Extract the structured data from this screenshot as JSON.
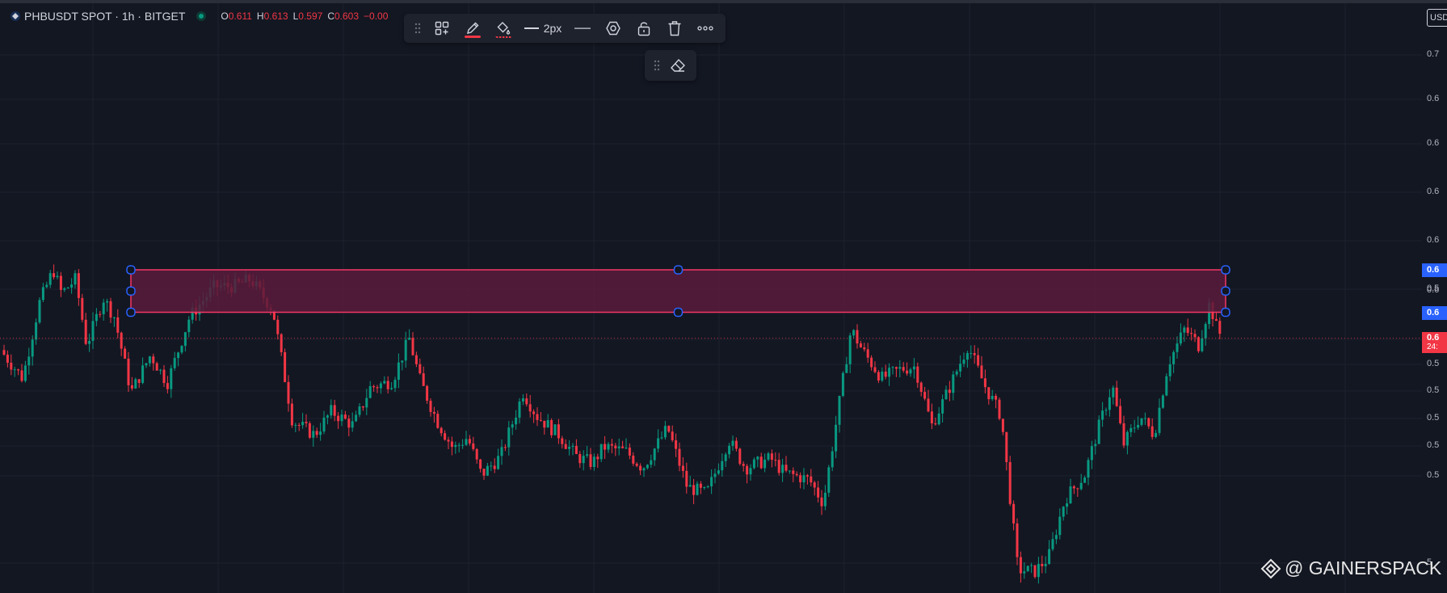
{
  "legend": {
    "symbol": "PHBUSDT SPOT · 1h · BITGET",
    "o_label": "O",
    "o_value": "0.611",
    "h_label": "H",
    "h_value": "0.613",
    "l_label": "L",
    "l_value": "0.597",
    "c_label": "C",
    "c_value": "0.603",
    "change": "−0.00"
  },
  "toolbar": {
    "grip_icon": "drag-handle-icon",
    "templates_icon": "templates-icon",
    "pencil_icon": "pencil-icon",
    "fill_icon": "fill-bucket-icon",
    "line_width_label": "2px",
    "line_style_icon": "line-style-icon",
    "settings_icon": "hexagon-settings-icon",
    "lock_icon": "unlock-icon",
    "delete_icon": "trash-icon",
    "more_icon": "more-icon",
    "eraser_icon": "eraser-icon"
  },
  "axis": {
    "currency_button": "USD",
    "ticks": [
      "0.7",
      "0.6",
      "0.6",
      "0.6",
      "0.6",
      "0.5",
      "0.5",
      "0.5",
      "0.5",
      "0.5",
      "0.5",
      "0.5",
      "5"
    ],
    "tag_top": "0.6",
    "tag_mid": "0.6",
    "tag_bottom": "0.6",
    "tag_current": "0.6",
    "tag_countdown": "24:"
  },
  "colors": {
    "background": "#131722",
    "up": "#089981",
    "down": "#f23645",
    "rect_fill": "#5b1b3b",
    "rect_border": "#f23665",
    "handle": "#2962ff"
  },
  "watermark": "@ GAINERSPACK",
  "chart_data": {
    "type": "candlestick",
    "symbol": "PHBUSDT",
    "interval": "1h",
    "exchange": "BITGET",
    "last_ohlc": {
      "open": 0.611,
      "high": 0.613,
      "low": 0.597,
      "close": 0.603
    },
    "trend": [
      [
        0,
        0.598
      ],
      [
        0.04,
        0.586
      ],
      [
        0.07,
        0.618
      ],
      [
        0.095,
        0.632
      ],
      [
        0.11,
        0.622
      ],
      [
        0.135,
        0.628
      ],
      [
        0.155,
        0.6
      ],
      [
        0.185,
        0.62
      ],
      [
        0.205,
        0.612
      ],
      [
        0.235,
        0.58
      ],
      [
        0.27,
        0.596
      ],
      [
        0.3,
        0.584
      ],
      [
        0.34,
        0.612
      ],
      [
        0.385,
        0.625
      ],
      [
        0.42,
        0.625
      ],
      [
        0.45,
        0.628
      ],
      [
        0.49,
        0.615
      ],
      [
        0.525,
        0.568
      ],
      [
        0.565,
        0.562
      ],
      [
        0.595,
        0.572
      ],
      [
        0.635,
        0.566
      ],
      [
        0.665,
        0.582
      ],
      [
        0.705,
        0.585
      ],
      [
        0.735,
        0.603
      ],
      [
        0.755,
        0.585
      ],
      [
        0.785,
        0.568
      ],
      [
        0.815,
        0.556
      ],
      [
        0.84,
        0.561
      ],
      [
        0.865,
        0.545
      ],
      [
        0.9,
        0.553
      ],
      [
        0.94,
        0.58
      ],
      [
        0.965,
        0.57
      ],
      [
        1.005,
        0.562
      ],
      [
        1.035,
        0.553
      ],
      [
        1.065,
        0.55
      ],
      [
        1.085,
        0.557
      ],
      [
        1.125,
        0.555
      ],
      [
        1.155,
        0.548
      ],
      [
        1.2,
        0.565
      ],
      [
        1.235,
        0.54
      ],
      [
        1.27,
        0.537
      ],
      [
        1.31,
        0.56
      ],
      [
        1.34,
        0.548
      ],
      [
        1.385,
        0.552
      ],
      [
        1.41,
        0.546
      ],
      [
        1.455,
        0.543
      ],
      [
        1.48,
        0.533
      ],
      [
        1.53,
        0.607
      ],
      [
        1.55,
        0.598
      ],
      [
        1.585,
        0.586
      ],
      [
        1.62,
        0.59
      ],
      [
        1.645,
        0.591
      ],
      [
        1.675,
        0.566
      ],
      [
        1.705,
        0.581
      ],
      [
        1.74,
        0.6
      ],
      [
        1.77,
        0.583
      ],
      [
        1.8,
        0.57
      ],
      [
        1.83,
        0.505
      ],
      [
        1.86,
        0.504
      ],
      [
        1.885,
        0.51
      ],
      [
        1.915,
        0.535
      ],
      [
        1.95,
        0.545
      ],
      [
        1.975,
        0.565
      ],
      [
        2.0,
        0.583
      ],
      [
        2.02,
        0.558
      ],
      [
        2.05,
        0.57
      ],
      [
        2.075,
        0.562
      ],
      [
        2.1,
        0.592
      ],
      [
        2.13,
        0.607
      ],
      [
        2.155,
        0.6
      ],
      [
        2.175,
        0.618
      ],
      [
        2.19,
        0.605
      ]
    ],
    "rectangle": {
      "top": 0.632,
      "bottom": 0.614
    },
    "current_price_line": 0.603
  }
}
